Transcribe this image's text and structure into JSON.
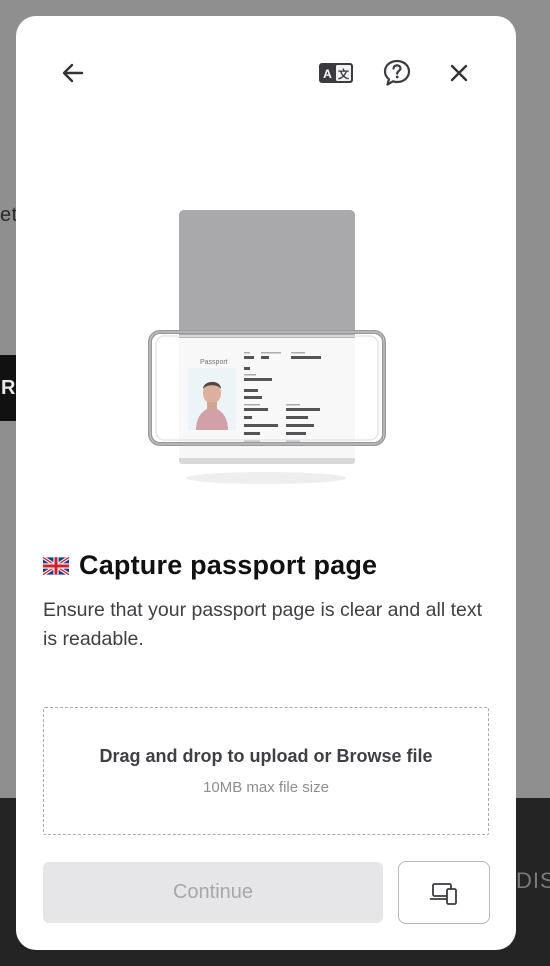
{
  "background": {
    "side_text": "et",
    "tab_text": "RA",
    "footer_text": "DISC"
  },
  "header": {
    "back": "arrow-left-icon",
    "language": "translate-icon",
    "help": "help-chat-icon",
    "close": "close-icon"
  },
  "illustration": {
    "passport_label": "Passport"
  },
  "content": {
    "flag": "uk-flag-icon",
    "title": "Capture passport page",
    "description": "Ensure that your passport page is clear and all text is readable."
  },
  "dropzone": {
    "main_text": "Drag and drop to upload or Browse file",
    "sub_text": "10MB max file size"
  },
  "footer": {
    "continue_label": "Continue",
    "device_icon": "devices-icon"
  },
  "colors": {
    "overlay": "#8f8f8f",
    "modal_bg": "#ffffff",
    "disabled_button": "#e6e6e8",
    "title_text": "#111111"
  }
}
